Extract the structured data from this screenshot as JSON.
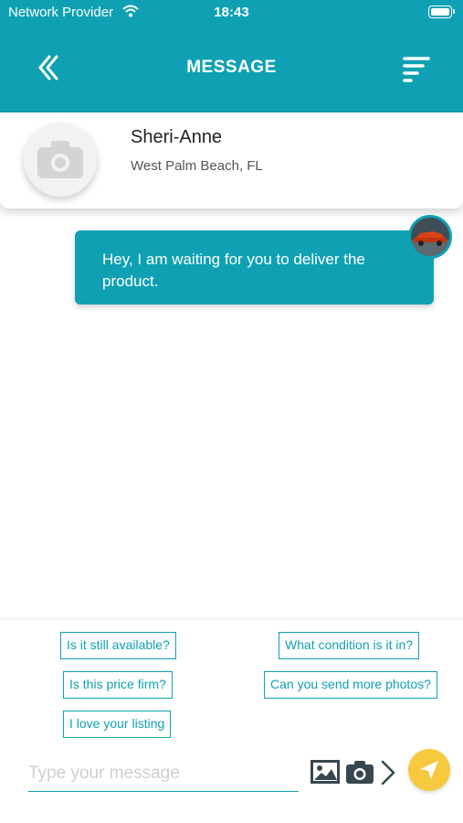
{
  "status_bar": {
    "carrier": "Network Provider",
    "time": "18:43"
  },
  "header": {
    "title": "MESSAGE",
    "back_icon": "chevron-left-icon",
    "menu_icon": "filter-lines-icon",
    "background_color": "#0fa1b3"
  },
  "contact": {
    "name": "Sheri-Anne",
    "location": "West Palm Beach, FL",
    "avatar_icon": "camera-placeholder-icon"
  },
  "messages": [
    {
      "text": "Hey, I am waiting for you to deliver the product.",
      "from": "me"
    }
  ],
  "quick_replies": [
    "Is it still available?",
    "What condition is it in?",
    "Is this price firm?",
    "Can you send more photos?",
    "I love your listing"
  ],
  "composer": {
    "placeholder": "Type your message",
    "gallery_icon": "image-icon",
    "camera_icon": "camera-icon",
    "expand_icon": "chevron-right-icon",
    "send_icon": "send-icon",
    "send_color": "#f6c93f"
  }
}
